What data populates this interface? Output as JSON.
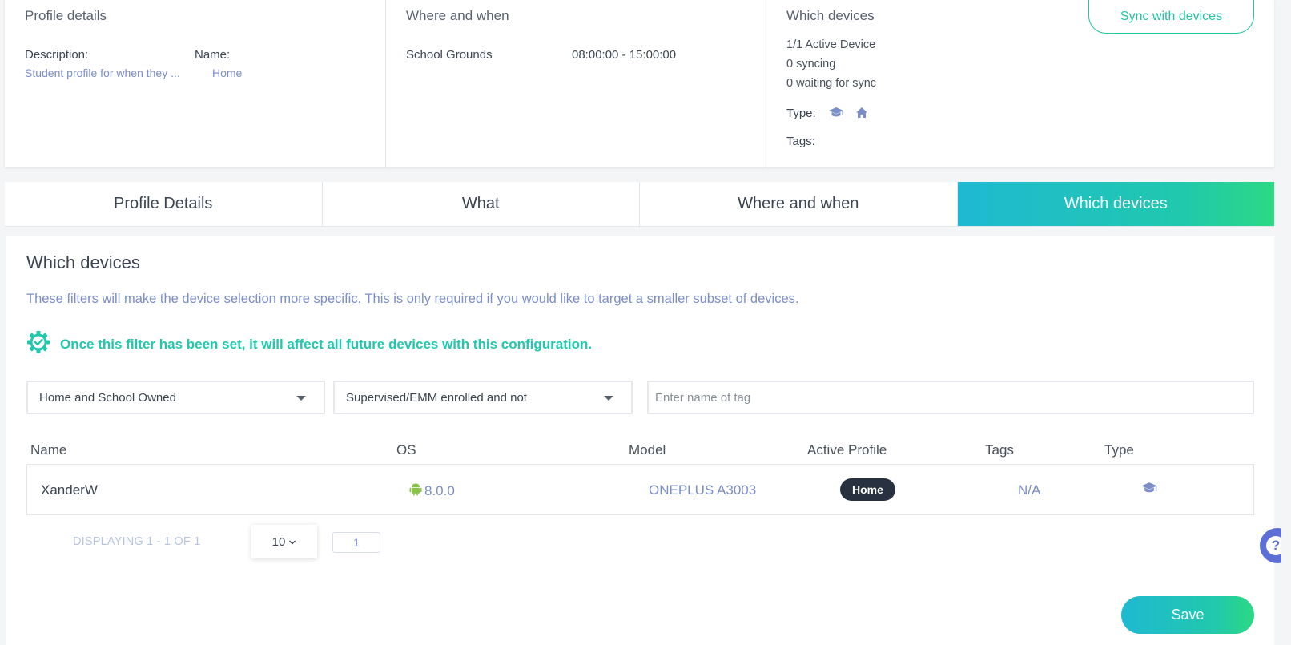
{
  "summary": {
    "profile_details": {
      "title": "Profile details",
      "description_label": "Description:",
      "description_value": "Student profile for when they ...",
      "name_label": "Name:",
      "name_value": "Home"
    },
    "where_when": {
      "title": "Where and when",
      "location": "School Grounds",
      "time": "08:00:00 - 15:00:00"
    },
    "which_devices": {
      "title": "Which devices",
      "active": "1/1 Active Device",
      "syncing": "0 syncing",
      "waiting": "0 waiting for sync",
      "type_label": "Type:",
      "type_icons": [
        "graduation-cap-icon",
        "home-icon"
      ],
      "tags_label": "Tags:",
      "sync_button": "Sync with devices"
    }
  },
  "tabs": [
    {
      "label": "Profile Details",
      "active": false
    },
    {
      "label": "What",
      "active": false
    },
    {
      "label": "Where and when",
      "active": false
    },
    {
      "label": "Which devices",
      "active": true
    }
  ],
  "panel": {
    "title": "Which devices",
    "description": "These filters will make the device selection more specific. This is only required if you would like to target a smaller subset of devices.",
    "notice": "Once this filter has been set, it will affect all future devices with this configuration.",
    "filters": {
      "ownership": "Home and School Owned",
      "supervision": "Supervised/EMM enrolled and not",
      "tag_placeholder": "Enter name of tag"
    },
    "table": {
      "headers": [
        "Name",
        "OS",
        "Model",
        "Active Profile",
        "Tags",
        "Type"
      ],
      "rows": [
        {
          "name": "XanderW",
          "os": "8.0.0",
          "os_icon": "android-icon",
          "model": "ONEPLUS A3003",
          "active_profile": "Home",
          "tags": "N/A",
          "type_icon": "graduation-cap-icon"
        }
      ]
    },
    "pager": {
      "displaying": "DISPLAYING 1 - 1 OF 1",
      "page_size": "10",
      "page": "1"
    },
    "save": "Save"
  },
  "colors": {
    "accent": "#20c8ae",
    "link": "#7b8ec8",
    "badge": "#27313f",
    "help": "#5b6fd6"
  }
}
